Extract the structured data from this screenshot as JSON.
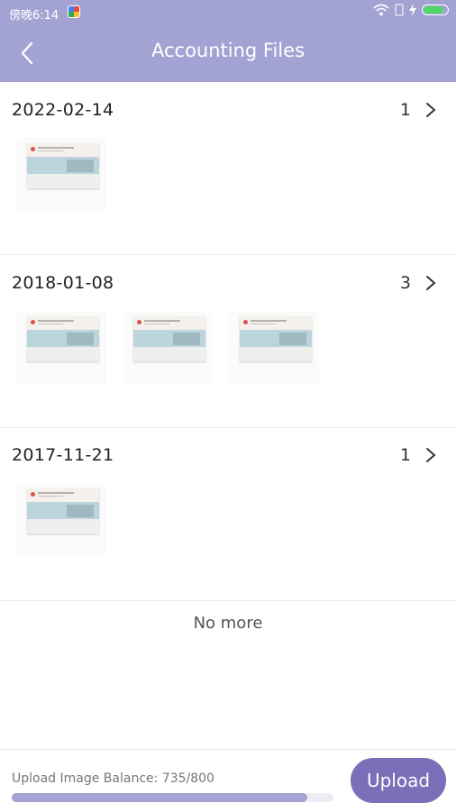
{
  "status_bar": {
    "time": "傍晚6:14",
    "app_icon": "colorful-app-icon",
    "wifi_icon": "wifi-icon",
    "sim_icon": "sim-icon",
    "charging_icon": "lightning-icon",
    "battery_level": 0.85
  },
  "header": {
    "title": "Accounting Files",
    "back_icon": "chevron-left-icon"
  },
  "groups": [
    {
      "date": "2022-02-14",
      "count": "1",
      "thumbnails": 1
    },
    {
      "date": "2018-01-08",
      "count": "3",
      "thumbnails": 3
    },
    {
      "date": "2017-11-21",
      "count": "1",
      "thumbnails": 1
    }
  ],
  "list_end": "No more",
  "footer": {
    "balance_label": "Upload Image Balance: 735/800",
    "progress": 0.919,
    "upload_label": "Upload"
  },
  "colors": {
    "accent": "#a3a3d3",
    "button": "#7a6fb8"
  }
}
